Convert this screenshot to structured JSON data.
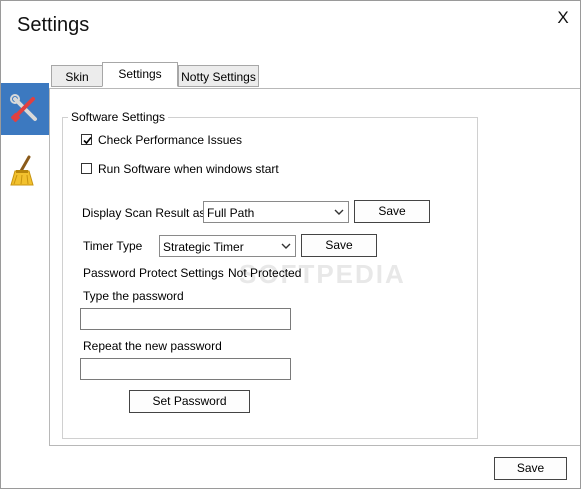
{
  "window": {
    "title": "Settings",
    "close_label": "X"
  },
  "rail": {
    "items": [
      {
        "icon": "tools-icon",
        "active": true
      },
      {
        "icon": "broom-icon",
        "active": false
      }
    ]
  },
  "tabs": [
    {
      "label": "Skin"
    },
    {
      "label": "Settings"
    },
    {
      "label": "Notty Settings"
    }
  ],
  "software": {
    "group_title": "Software Settings",
    "check_performance": {
      "label": "Check Performance Issues",
      "checked": true
    },
    "run_on_start": {
      "label": "Run Software when windows start",
      "checked": false
    },
    "display_scan": {
      "label": "Display Scan Result as",
      "value": "Full Path",
      "save_label": "Save"
    },
    "timer_type": {
      "label": "Timer Type",
      "value": "Strategic Timer",
      "save_label": "Save"
    },
    "password_protect": {
      "label": "Password Protect Settings",
      "status": "Not Protected"
    },
    "type_password": {
      "label": "Type the password",
      "value": ""
    },
    "repeat_password": {
      "label": "Repeat the new password",
      "value": ""
    },
    "set_password_label": "Set Password"
  },
  "footer": {
    "save_label": "Save"
  },
  "watermark": "SOFTPEDIA"
}
